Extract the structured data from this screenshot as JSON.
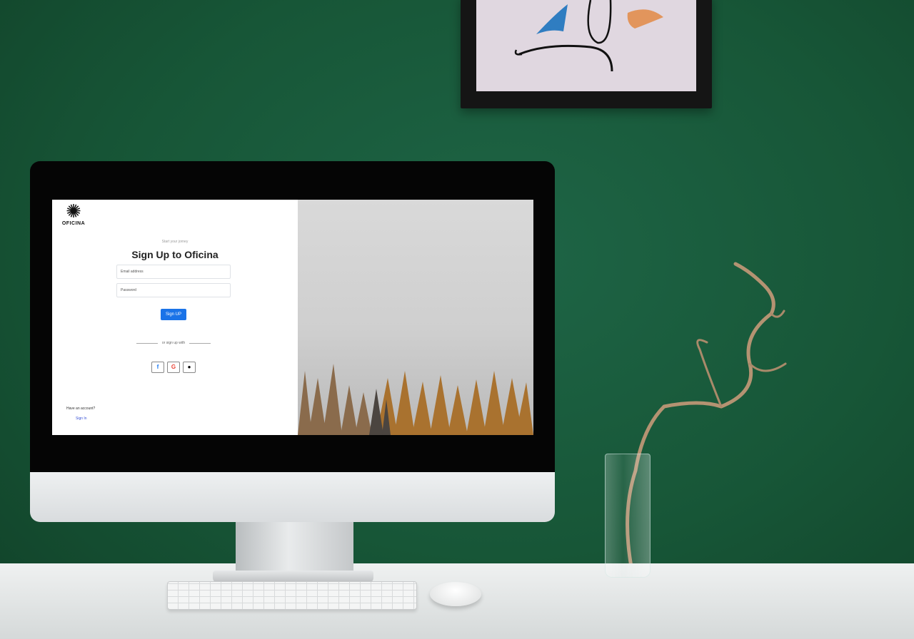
{
  "screen": {
    "logo_text": "OFICINA",
    "tagline": "Start your jorney",
    "title": "Sign Up to Oficina",
    "email_placeholder": "Email address",
    "password_placeholder": "Password",
    "signup_button": "Sign UP",
    "divider_text": "or sign up with",
    "social": [
      {
        "name": "facebook-icon",
        "glyph": "f",
        "color": "#1877f2"
      },
      {
        "name": "google-icon",
        "glyph": "G",
        "color": "#ea4335"
      },
      {
        "name": "apple-icon",
        "glyph": "",
        "color": "#000000"
      }
    ],
    "have_account": "Have an account?",
    "signin_link": "Sign In"
  },
  "colors": {
    "wall": "#175637",
    "primary_button": "#1a73e8",
    "link": "#3b54d6"
  }
}
